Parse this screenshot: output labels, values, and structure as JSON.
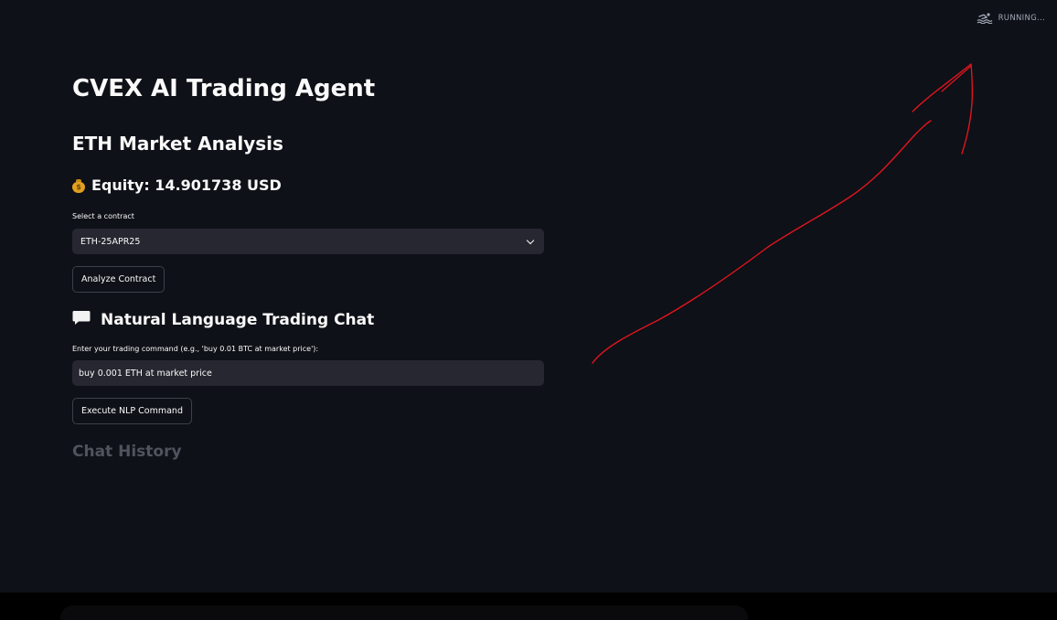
{
  "status": {
    "text": "RUNNING...",
    "icon": "running-swimmer-icon"
  },
  "header": {
    "title": "CVEX AI Trading Agent",
    "subtitle": "ETH Market Analysis"
  },
  "equity": {
    "icon": "money-bag-icon",
    "text": "Equity: 14.901738 USD"
  },
  "contract": {
    "label": "Select a contract",
    "selected": "ETH-25APR25",
    "analyze_button": "Analyze Contract"
  },
  "chat": {
    "icon": "speech-bubble-icon",
    "heading": "Natural Language Trading Chat",
    "input_label": "Enter your trading command (e.g., 'buy 0.01 BTC at market price'):",
    "input_value": "buy 0.001 ETH at market price",
    "execute_button": "Execute NLP Command",
    "history_heading": "Chat History"
  },
  "colors": {
    "background": "#0e1117",
    "input_bg": "#262730",
    "text": "#fafafa",
    "muted_heading": "#4f535d",
    "annotation_stroke": "#e0141e"
  }
}
